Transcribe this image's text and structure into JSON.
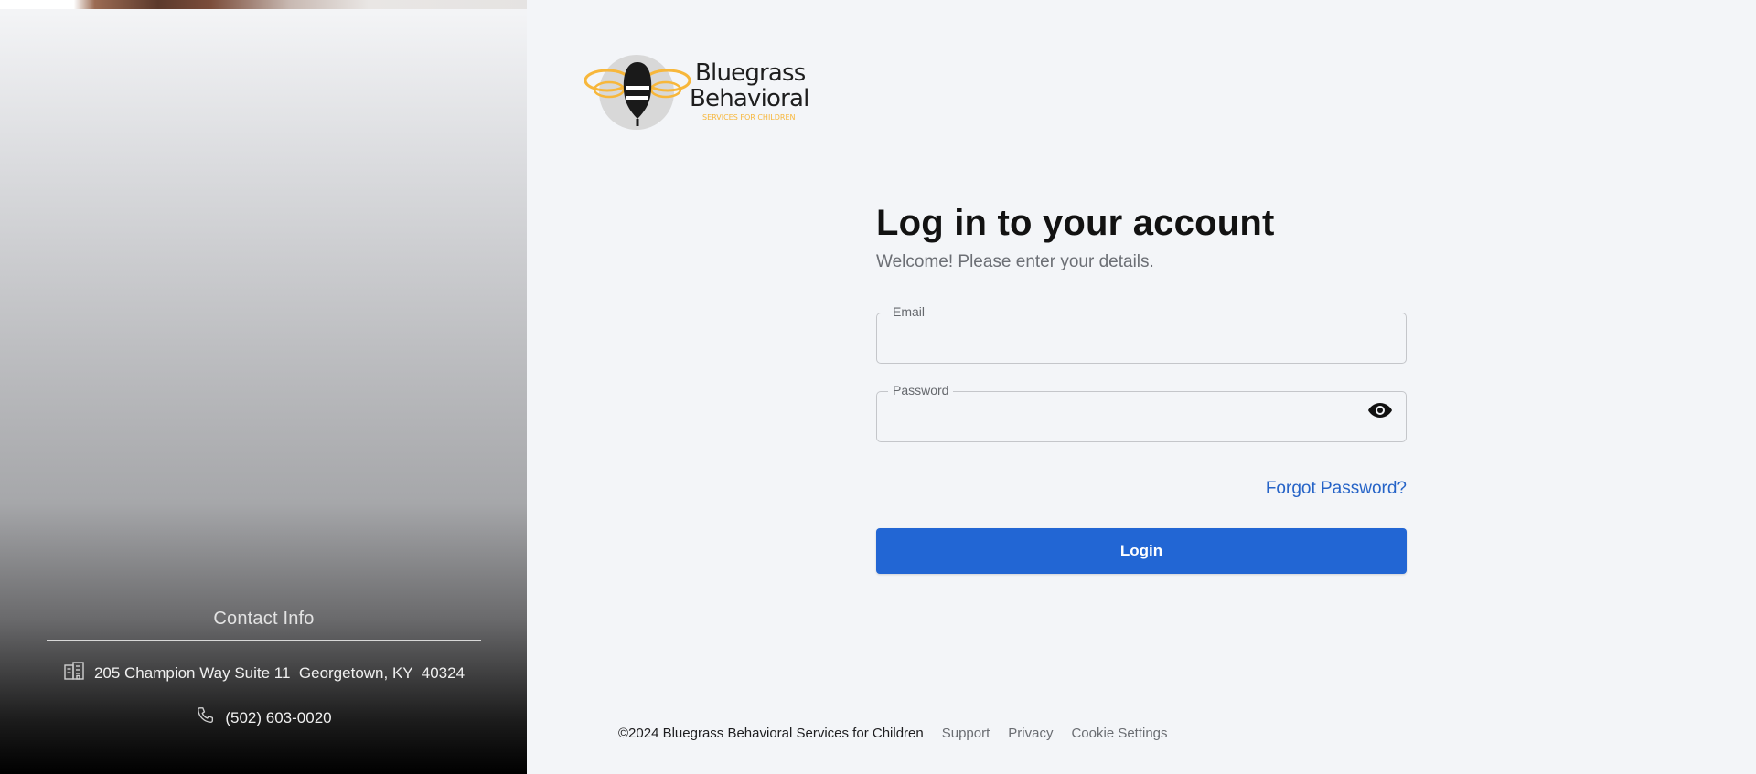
{
  "brand": {
    "name_line1": "Bluegrass",
    "name_line2": "Behavioral",
    "tagline": "SERVICES FOR CHILDREN",
    "accent_color": "#f7b73b"
  },
  "contact": {
    "title": "Contact Info",
    "address": "205 Champion Way Suite 11  Georgetown, KY  40324",
    "phone": "(502) 603-0020",
    "address_icon": "building-icon",
    "phone_icon": "phone-icon"
  },
  "login": {
    "heading": "Log in to your account",
    "subheading": "Welcome! Please enter your details.",
    "email_label": "Email",
    "email_value": "",
    "password_label": "Password",
    "password_value": "",
    "show_password_icon": "eye-icon",
    "forgot_password": "Forgot Password?",
    "login_button": "Login",
    "primary_color": "#2266d4",
    "link_color": "#2563c7"
  },
  "footer": {
    "copyright": "©2024 Bluegrass Behavioral Services for Children",
    "links": [
      "Support",
      "Privacy",
      "Cookie Settings"
    ]
  }
}
